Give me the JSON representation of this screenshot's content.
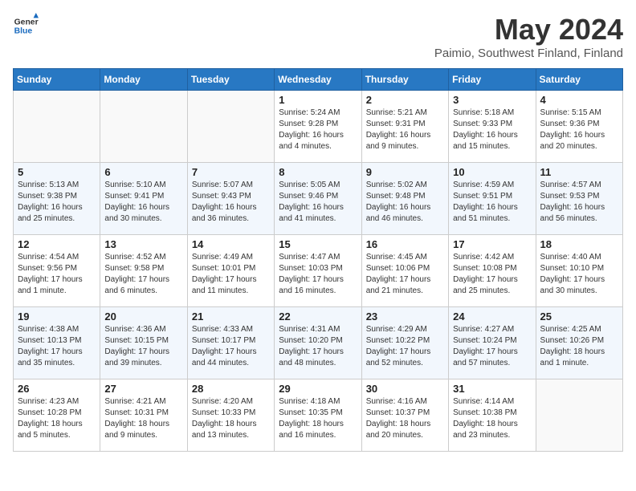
{
  "header": {
    "logo_general": "General",
    "logo_blue": "Blue",
    "month": "May 2024",
    "location": "Paimio, Southwest Finland, Finland"
  },
  "weekdays": [
    "Sunday",
    "Monday",
    "Tuesday",
    "Wednesday",
    "Thursday",
    "Friday",
    "Saturday"
  ],
  "weeks": [
    [
      {
        "day": "",
        "sunrise": "",
        "sunset": "",
        "daylight": ""
      },
      {
        "day": "",
        "sunrise": "",
        "sunset": "",
        "daylight": ""
      },
      {
        "day": "",
        "sunrise": "",
        "sunset": "",
        "daylight": ""
      },
      {
        "day": "1",
        "sunrise": "Sunrise: 5:24 AM",
        "sunset": "Sunset: 9:28 PM",
        "daylight": "Daylight: 16 hours and 4 minutes."
      },
      {
        "day": "2",
        "sunrise": "Sunrise: 5:21 AM",
        "sunset": "Sunset: 9:31 PM",
        "daylight": "Daylight: 16 hours and 9 minutes."
      },
      {
        "day": "3",
        "sunrise": "Sunrise: 5:18 AM",
        "sunset": "Sunset: 9:33 PM",
        "daylight": "Daylight: 16 hours and 15 minutes."
      },
      {
        "day": "4",
        "sunrise": "Sunrise: 5:15 AM",
        "sunset": "Sunset: 9:36 PM",
        "daylight": "Daylight: 16 hours and 20 minutes."
      }
    ],
    [
      {
        "day": "5",
        "sunrise": "Sunrise: 5:13 AM",
        "sunset": "Sunset: 9:38 PM",
        "daylight": "Daylight: 16 hours and 25 minutes."
      },
      {
        "day": "6",
        "sunrise": "Sunrise: 5:10 AM",
        "sunset": "Sunset: 9:41 PM",
        "daylight": "Daylight: 16 hours and 30 minutes."
      },
      {
        "day": "7",
        "sunrise": "Sunrise: 5:07 AM",
        "sunset": "Sunset: 9:43 PM",
        "daylight": "Daylight: 16 hours and 36 minutes."
      },
      {
        "day": "8",
        "sunrise": "Sunrise: 5:05 AM",
        "sunset": "Sunset: 9:46 PM",
        "daylight": "Daylight: 16 hours and 41 minutes."
      },
      {
        "day": "9",
        "sunrise": "Sunrise: 5:02 AM",
        "sunset": "Sunset: 9:48 PM",
        "daylight": "Daylight: 16 hours and 46 minutes."
      },
      {
        "day": "10",
        "sunrise": "Sunrise: 4:59 AM",
        "sunset": "Sunset: 9:51 PM",
        "daylight": "Daylight: 16 hours and 51 minutes."
      },
      {
        "day": "11",
        "sunrise": "Sunrise: 4:57 AM",
        "sunset": "Sunset: 9:53 PM",
        "daylight": "Daylight: 16 hours and 56 minutes."
      }
    ],
    [
      {
        "day": "12",
        "sunrise": "Sunrise: 4:54 AM",
        "sunset": "Sunset: 9:56 PM",
        "daylight": "Daylight: 17 hours and 1 minute."
      },
      {
        "day": "13",
        "sunrise": "Sunrise: 4:52 AM",
        "sunset": "Sunset: 9:58 PM",
        "daylight": "Daylight: 17 hours and 6 minutes."
      },
      {
        "day": "14",
        "sunrise": "Sunrise: 4:49 AM",
        "sunset": "Sunset: 10:01 PM",
        "daylight": "Daylight: 17 hours and 11 minutes."
      },
      {
        "day": "15",
        "sunrise": "Sunrise: 4:47 AM",
        "sunset": "Sunset: 10:03 PM",
        "daylight": "Daylight: 17 hours and 16 minutes."
      },
      {
        "day": "16",
        "sunrise": "Sunrise: 4:45 AM",
        "sunset": "Sunset: 10:06 PM",
        "daylight": "Daylight: 17 hours and 21 minutes."
      },
      {
        "day": "17",
        "sunrise": "Sunrise: 4:42 AM",
        "sunset": "Sunset: 10:08 PM",
        "daylight": "Daylight: 17 hours and 25 minutes."
      },
      {
        "day": "18",
        "sunrise": "Sunrise: 4:40 AM",
        "sunset": "Sunset: 10:10 PM",
        "daylight": "Daylight: 17 hours and 30 minutes."
      }
    ],
    [
      {
        "day": "19",
        "sunrise": "Sunrise: 4:38 AM",
        "sunset": "Sunset: 10:13 PM",
        "daylight": "Daylight: 17 hours and 35 minutes."
      },
      {
        "day": "20",
        "sunrise": "Sunrise: 4:36 AM",
        "sunset": "Sunset: 10:15 PM",
        "daylight": "Daylight: 17 hours and 39 minutes."
      },
      {
        "day": "21",
        "sunrise": "Sunrise: 4:33 AM",
        "sunset": "Sunset: 10:17 PM",
        "daylight": "Daylight: 17 hours and 44 minutes."
      },
      {
        "day": "22",
        "sunrise": "Sunrise: 4:31 AM",
        "sunset": "Sunset: 10:20 PM",
        "daylight": "Daylight: 17 hours and 48 minutes."
      },
      {
        "day": "23",
        "sunrise": "Sunrise: 4:29 AM",
        "sunset": "Sunset: 10:22 PM",
        "daylight": "Daylight: 17 hours and 52 minutes."
      },
      {
        "day": "24",
        "sunrise": "Sunrise: 4:27 AM",
        "sunset": "Sunset: 10:24 PM",
        "daylight": "Daylight: 17 hours and 57 minutes."
      },
      {
        "day": "25",
        "sunrise": "Sunrise: 4:25 AM",
        "sunset": "Sunset: 10:26 PM",
        "daylight": "Daylight: 18 hours and 1 minute."
      }
    ],
    [
      {
        "day": "26",
        "sunrise": "Sunrise: 4:23 AM",
        "sunset": "Sunset: 10:28 PM",
        "daylight": "Daylight: 18 hours and 5 minutes."
      },
      {
        "day": "27",
        "sunrise": "Sunrise: 4:21 AM",
        "sunset": "Sunset: 10:31 PM",
        "daylight": "Daylight: 18 hours and 9 minutes."
      },
      {
        "day": "28",
        "sunrise": "Sunrise: 4:20 AM",
        "sunset": "Sunset: 10:33 PM",
        "daylight": "Daylight: 18 hours and 13 minutes."
      },
      {
        "day": "29",
        "sunrise": "Sunrise: 4:18 AM",
        "sunset": "Sunset: 10:35 PM",
        "daylight": "Daylight: 18 hours and 16 minutes."
      },
      {
        "day": "30",
        "sunrise": "Sunrise: 4:16 AM",
        "sunset": "Sunset: 10:37 PM",
        "daylight": "Daylight: 18 hours and 20 minutes."
      },
      {
        "day": "31",
        "sunrise": "Sunrise: 4:14 AM",
        "sunset": "Sunset: 10:38 PM",
        "daylight": "Daylight: 18 hours and 23 minutes."
      },
      {
        "day": "",
        "sunrise": "",
        "sunset": "",
        "daylight": ""
      }
    ]
  ]
}
